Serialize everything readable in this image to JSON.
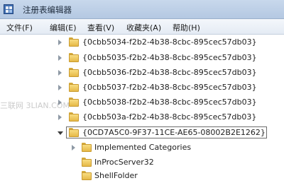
{
  "window": {
    "title": "注册表编辑器"
  },
  "menu": {
    "items": [
      "文件(F)",
      "编辑(E)",
      "查看(V)",
      "收藏夹(A)",
      "帮助(H)"
    ]
  },
  "tree": {
    "keys": [
      {
        "label": "{0cbb5034-f2b2-4b38-8cbc-895cec57db03}",
        "expanded": false,
        "selected": false
      },
      {
        "label": "{0cbb5035-f2b2-4b38-8cbc-895cec57db03}",
        "expanded": false,
        "selected": false
      },
      {
        "label": "{0cbb5036-f2b2-4b38-8cbc-895cec57db03}",
        "expanded": false,
        "selected": false
      },
      {
        "label": "{0cbb5037-f2b2-4b38-8cbc-895cec57db03}",
        "expanded": false,
        "selected": false
      },
      {
        "label": "{0cbb5038-f2b2-4b38-8cbc-895cec57db03}",
        "expanded": false,
        "selected": false
      },
      {
        "label": "{0cbb503a-f2b2-4b38-8cbc-895cec57db03}",
        "expanded": false,
        "selected": false
      },
      {
        "label": "{0CD7A5C0-9F37-11CE-AE65-08002B2E1262}",
        "expanded": true,
        "selected": true
      }
    ],
    "subkeys": [
      {
        "label": "Implemented Categories",
        "has_children": true
      },
      {
        "label": "InProcServer32",
        "has_children": false
      },
      {
        "label": "ShellFolder",
        "has_children": false
      }
    ]
  },
  "watermark": {
    "text": "三联网 3LIAN.COM"
  }
}
